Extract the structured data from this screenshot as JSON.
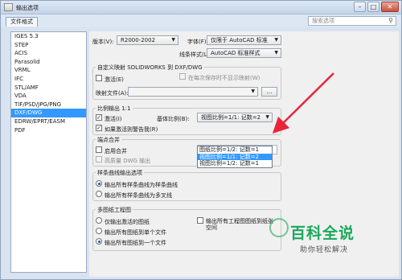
{
  "window": {
    "title": "输出选项",
    "controls": [
      "–",
      "□",
      "✕"
    ]
  },
  "subbar": {
    "tab": "文件格式",
    "search_placeholder": "搜索选项"
  },
  "formats": [
    "IGES 5.3",
    "STEP",
    "ACIS",
    "Parasolid",
    "VRML",
    "IFC",
    "STL/AMF",
    "VDA",
    "TIF/PSD/JPG/PNG",
    "DXF/DWG",
    "EDRW/EPRT/EASM",
    "PDF"
  ],
  "selected_format_index": 9,
  "top": {
    "version_label": "版本(V):",
    "version_value": "R2000-2002",
    "font_label": "字体(F):",
    "font_value": "仅限于 AutoCAD 标准",
    "linestyle_label": "线条样式(L):",
    "linestyle_value": "AutoCAD 标准样式"
  },
  "custom_map": {
    "title": "自定义映射 SOLIDWORKS 到 DXF/DWG",
    "activate": "激活(E)",
    "prompt_each_save": "在每次保存时不显示映射(W)",
    "map_file_label": "映射文件(A):",
    "browse": "..."
  },
  "scale": {
    "title": "比例输出 1:1",
    "activate": "激活(I)",
    "warn": "如果激活则警告我(R)",
    "base_scale_label": "基体比例(B):",
    "combo_value": "视图比例=1/1: 记数=2",
    "options": [
      "图纸比例=1/2: 记数=1",
      "视图比例=1/1: 记数=2",
      "视图比例=1/2: 记数=1"
    ],
    "highlighted_option": 1
  },
  "merge": {
    "title": "端点合并",
    "enable": "启用合并",
    "hq_dwg": "高质量 DWG 输出",
    "value": "0"
  },
  "spline": {
    "title": "样条曲线输出选项",
    "opt1": "输出所有样条曲线为样条曲线",
    "opt2": "输出所有样条曲线为多叉线"
  },
  "multi_sheet": {
    "title": "多图纸工程图",
    "opt1": "仅输出激活的图纸",
    "opt2": "输出所有图纸到单个文件",
    "opt3": "输出所有图纸到一个文件",
    "all_to_paper_space": "输出所有工程图图纸到纸张空间"
  },
  "watermark": {
    "title": "百科全说",
    "subtitle": "助你轻松解决"
  },
  "colors": {
    "accent": "#3399ff",
    "arrow": "#e8253b",
    "brand": "#19a85b"
  }
}
